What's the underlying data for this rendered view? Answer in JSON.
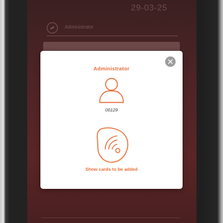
{
  "background": {
    "date": "29-03-25",
    "header_label": "Administrator"
  },
  "dialog": {
    "title": "Administrator",
    "user_code": "00129",
    "hint": "Show cards to be added",
    "close_icon": "close-icon",
    "avatar_icon": "user-icon",
    "card_icon": "rfid-card-icon"
  },
  "colors": {
    "accent": "#e8703a",
    "screen_bg": "#4e2426",
    "dialog_bg": "#ffffff",
    "close_bg": "#9c9c9c"
  }
}
